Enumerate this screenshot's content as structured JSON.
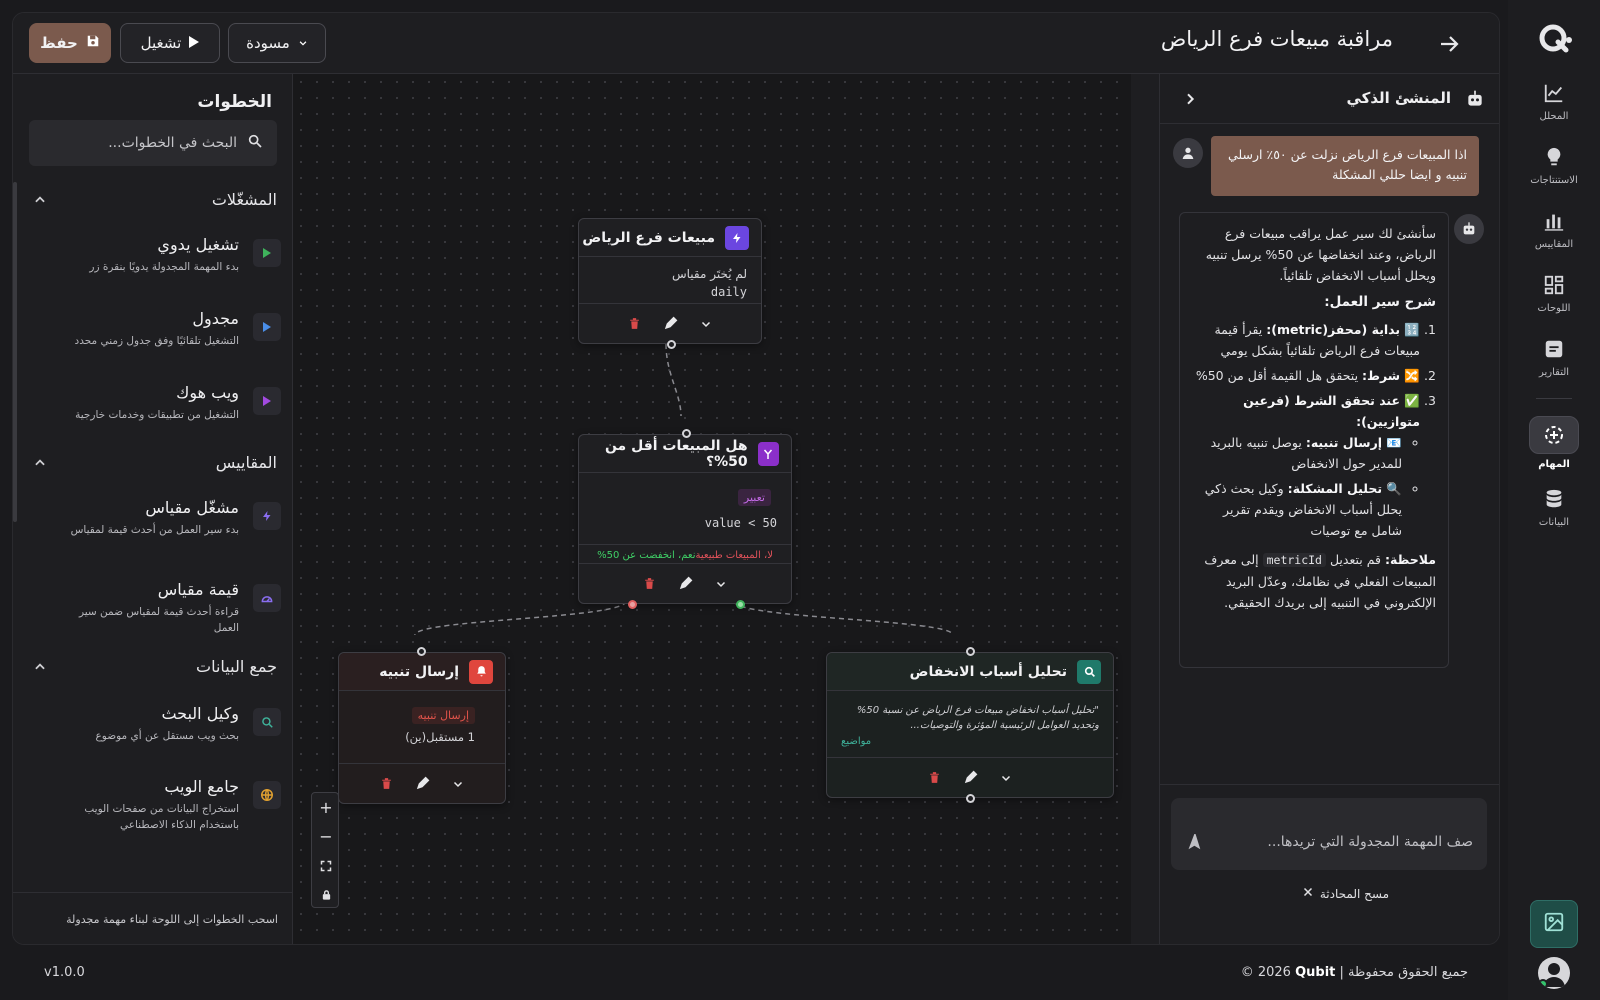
{
  "app": {
    "title": "مراقبة مبيعات فرع الرياض",
    "save_label": "حفظ",
    "run_label": "تشغيل",
    "draft_label": "مسودة"
  },
  "nav": {
    "items": [
      {
        "label": "المحلل",
        "icon": "line-chart-icon"
      },
      {
        "label": "الاستنتاجات",
        "icon": "lightbulb-icon"
      },
      {
        "label": "المقاييس",
        "icon": "bar-chart-icon"
      },
      {
        "label": "اللوحات",
        "icon": "dashboard-icon"
      },
      {
        "label": "التقارير",
        "icon": "report-icon"
      },
      {
        "label": "المهام",
        "icon": "tasks-icon"
      },
      {
        "label": "البيانات",
        "icon": "database-icon"
      }
    ],
    "active": "المهام"
  },
  "steps": {
    "title": "الخطوات",
    "search_placeholder": "البحث في الخطوات...",
    "sections": [
      {
        "label": "المشغّلات",
        "items": [
          {
            "name": "تشغيل يدوي",
            "desc": "بدء المهمة المجدولة يدويًا بنقرة زر"
          },
          {
            "name": "مجدول",
            "desc": "التشغيل تلقائيًا وفق جدول زمني محدد"
          },
          {
            "name": "ويب هوك",
            "desc": "التشغيل من تطبيقات وخدمات خارجية"
          }
        ]
      },
      {
        "label": "المقاييس",
        "items": [
          {
            "name": "مشغّل مقياس",
            "desc": "بدء سير العمل من أحدث قيمة لمقياس"
          },
          {
            "name": "قيمة مقياس",
            "desc": "قراءة أحدث قيمة لمقياس ضمن سير العمل"
          }
        ]
      },
      {
        "label": "جمع البيانات",
        "items": [
          {
            "name": "وكيل البحث",
            "desc": "بحث ويب مستقل عن أي موضوع"
          },
          {
            "name": "جامع الويب",
            "desc": "استخراج البيانات من صفحات الويب باستخدام الذكاء الاصطناعي"
          }
        ]
      }
    ],
    "footer": "اسحب الخطوات إلى اللوحة لبناء مهمة مجدولة"
  },
  "canvas": {
    "trigger": {
      "title": "مبيعات فرع الرياض",
      "line1": "لم يُختَر مقياس",
      "line2": "daily"
    },
    "condition": {
      "title": "هل المبيعات أقل من 50%؟",
      "tag": "تعبير",
      "expr": "value < 50",
      "yes": "نعم، انخفضت عن 50%",
      "no": "لا، المبيعات طبيعية"
    },
    "alert": {
      "title": "إرسال تنبيه",
      "tag": "إرسال تنبيه",
      "recipients": "1 مستقبل(ين)"
    },
    "analysis": {
      "title": "تحليل أسباب الانخفاض",
      "text": "\"تحليل أسباب انخفاض مبيعات فرع الرياض عن نسبة 50% وتحديد العوامل الرئيسية المؤثرة والتوصيات...",
      "topics": "مواضيع"
    }
  },
  "ai": {
    "title": "المنشئ الذكي",
    "user_msg": "اذا المبيعات فرع الرياض نزلت عن ٥٠٪ ارسلي تنبيه و ايضا حللي المشكلة",
    "intro": "سأنشئ لك سير عمل يراقب مبيعات فرع الرياض، وعند انخفاضها عن 50% يرسل تنبيه ويحلل أسباب الانخفاض تلقائياً.",
    "explain_title": "شرح سير العمل:",
    "s1_bold": "🔢 بداية (محفز(metric):",
    "s1_text": " يقرأ قيمة مبيعات فرع الرياض تلقائياً بشكل يومي",
    "s2_bold": "🔀 شرط:",
    "s2_text": " يتحقق هل القيمة أقل من 50%",
    "s3_bold": "✅ عند تحقق الشرط (فرعين متوازيين):",
    "b1_bold": "📧 إرسال تنبيه:",
    "b1_text": " يوصل تنبيه بالبريد للمدير حول الانخفاض",
    "b2_bold": "🔍 تحليل المشكلة:",
    "b2_text": " وكيل بحث ذكي يحلل أسباب الانخفاض ويقدم تقرير شامل مع توصيات",
    "note_bold": "ملاحظة:",
    "note_pre": " قم بتعديل ",
    "note_code": "metricId",
    "note_post": " إلى معرف المبيعات الفعلي في نظامك، وعدّل البريد الإلكتروني في التنبيه إلى بريدك الحقيقي.",
    "input_placeholder": "صف المهمة المجدولة التي تريدها...",
    "clear_label": "مسح المحادثة"
  },
  "footer": {
    "version": "v1.0.0",
    "brand": "Qubit",
    "copyright": "© 2026",
    "rights": "جميع الحقوق محفوظة"
  },
  "colors": {
    "accent": "#7b5a4d",
    "trigger": "#6b46e0",
    "condition": "#8b2fc9",
    "alert": "#e0463d",
    "agent": "#1f7a6a"
  }
}
